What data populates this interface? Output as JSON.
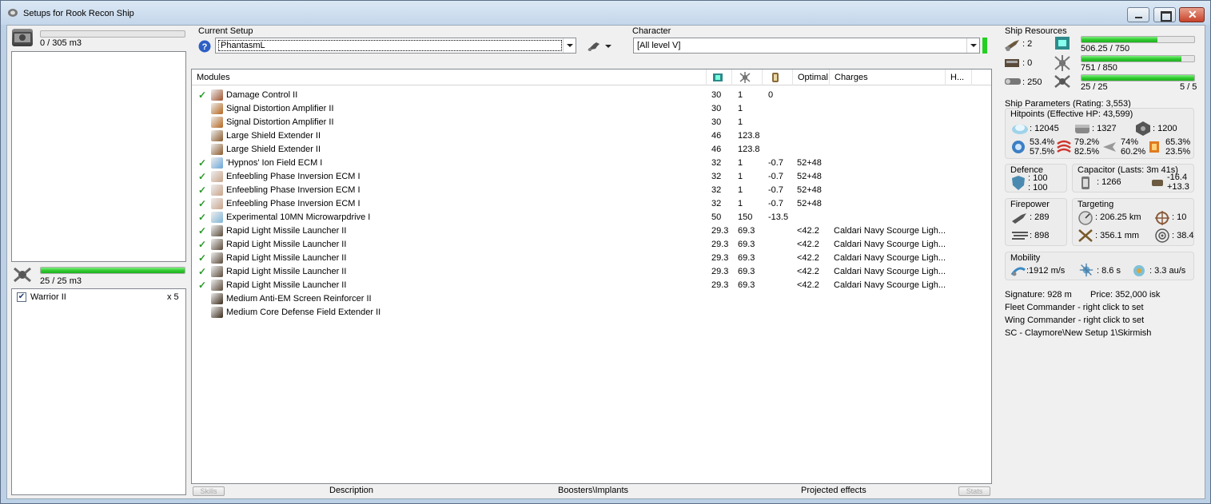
{
  "window": {
    "title": "Setups for Rook Recon Ship",
    "colors": {
      "frame": "#bcd0e6",
      "progress": "#2ec82e",
      "close": "#c7432b"
    }
  },
  "cargo": {
    "capacity_text": "0 / 305 m3",
    "fill": 0.0
  },
  "drones": {
    "capacity_text": "25 / 25 m3",
    "fill": 1.0,
    "items": [
      {
        "name": "Warrior II",
        "qty": "x 5",
        "checked": true
      }
    ]
  },
  "setup": {
    "label": "Current Setup",
    "value": "PhantasmL",
    "help_icon": "help-icon",
    "tools_icon": "wrench-icon"
  },
  "character": {
    "label": "Character",
    "value": "[All level V]"
  },
  "modules": {
    "headers": [
      "Modules",
      "",
      "",
      "",
      "Optimal",
      "Charges",
      "H..."
    ],
    "header_icons": [
      "cpu-icon",
      "powergrid-icon",
      "capacitor-icon"
    ],
    "rows": [
      {
        "active": true,
        "icon": "damage-control-icon",
        "color": "#a0522d",
        "name": "Damage Control II",
        "cpu": "30",
        "pg": "1",
        "cap": "0",
        "optimal": "",
        "charges": ""
      },
      {
        "active": false,
        "icon": "sig-amp-icon",
        "color": "#b5651d",
        "name": "Signal Distortion Amplifier II",
        "cpu": "30",
        "pg": "1",
        "cap": "",
        "optimal": "",
        "charges": ""
      },
      {
        "active": false,
        "icon": "sig-amp-icon",
        "color": "#b5651d",
        "name": "Signal Distortion Amplifier II",
        "cpu": "30",
        "pg": "1",
        "cap": "",
        "optimal": "",
        "charges": ""
      },
      {
        "active": false,
        "icon": "shield-extender-icon",
        "color": "#8b5a2b",
        "name": "Large Shield Extender II",
        "cpu": "46",
        "pg": "123.8",
        "cap": "",
        "optimal": "",
        "charges": ""
      },
      {
        "active": false,
        "icon": "shield-extender-icon",
        "color": "#8b5a2b",
        "name": "Large Shield Extender II",
        "cpu": "46",
        "pg": "123.8",
        "cap": "",
        "optimal": "",
        "charges": ""
      },
      {
        "active": true,
        "icon": "ecm-icon",
        "color": "#6aa6d8",
        "name": "'Hypnos' Ion Field ECM I",
        "cpu": "32",
        "pg": "1",
        "cap": "-0.7",
        "optimal": "52+48",
        "charges": ""
      },
      {
        "active": true,
        "icon": "ecm-icon",
        "color": "#c9a48a",
        "name": "Enfeebling Phase Inversion ECM I",
        "cpu": "32",
        "pg": "1",
        "cap": "-0.7",
        "optimal": "52+48",
        "charges": ""
      },
      {
        "active": true,
        "icon": "ecm-icon",
        "color": "#c9a48a",
        "name": "Enfeebling Phase Inversion ECM I",
        "cpu": "32",
        "pg": "1",
        "cap": "-0.7",
        "optimal": "52+48",
        "charges": ""
      },
      {
        "active": true,
        "icon": "ecm-icon",
        "color": "#c9a48a",
        "name": "Enfeebling Phase Inversion ECM I",
        "cpu": "32",
        "pg": "1",
        "cap": "-0.7",
        "optimal": "52+48",
        "charges": ""
      },
      {
        "active": true,
        "icon": "mwd-icon",
        "color": "#7fb5d6",
        "name": "Experimental 10MN Microwarpdrive I",
        "cpu": "50",
        "pg": "150",
        "cap": "-13.5",
        "optimal": "",
        "charges": ""
      },
      {
        "active": true,
        "icon": "missile-launcher-icon",
        "color": "#5a4a3a",
        "name": "Rapid Light Missile Launcher II",
        "cpu": "29.3",
        "pg": "69.3",
        "cap": "",
        "optimal": "<42.2",
        "charges": "Caldari Navy Scourge Ligh..."
      },
      {
        "active": true,
        "icon": "missile-launcher-icon",
        "color": "#5a4a3a",
        "name": "Rapid Light Missile Launcher II",
        "cpu": "29.3",
        "pg": "69.3",
        "cap": "",
        "optimal": "<42.2",
        "charges": "Caldari Navy Scourge Ligh..."
      },
      {
        "active": true,
        "icon": "missile-launcher-icon",
        "color": "#5a4a3a",
        "name": "Rapid Light Missile Launcher II",
        "cpu": "29.3",
        "pg": "69.3",
        "cap": "",
        "optimal": "<42.2",
        "charges": "Caldari Navy Scourge Ligh..."
      },
      {
        "active": true,
        "icon": "missile-launcher-icon",
        "color": "#5a4a3a",
        "name": "Rapid Light Missile Launcher II",
        "cpu": "29.3",
        "pg": "69.3",
        "cap": "",
        "optimal": "<42.2",
        "charges": "Caldari Navy Scourge Ligh..."
      },
      {
        "active": true,
        "icon": "missile-launcher-icon",
        "color": "#5a4a3a",
        "name": "Rapid Light Missile Launcher II",
        "cpu": "29.3",
        "pg": "69.3",
        "cap": "",
        "optimal": "<42.2",
        "charges": "Caldari Navy Scourge Ligh..."
      },
      {
        "active": false,
        "icon": "rig-icon",
        "color": "#3a2a1a",
        "name": "Medium Anti-EM Screen Reinforcer II",
        "cpu": "",
        "pg": "",
        "cap": "",
        "optimal": "",
        "charges": ""
      },
      {
        "active": false,
        "icon": "rig-icon",
        "color": "#3a2a1a",
        "name": "Medium Core Defense Field Extender II",
        "cpu": "",
        "pg": "",
        "cap": "",
        "optimal": "",
        "charges": ""
      }
    ]
  },
  "bottom_tabs": {
    "left_scroll": "Skills",
    "tabs": [
      "Description",
      "Boosters\\Implants",
      "Projected effects"
    ],
    "right_scroll": "Stats"
  },
  "resources": {
    "title": "Ship Resources",
    "turret_hardpoints": ": 2",
    "launcher_hardpoints": ": 0",
    "calibration": ": 250",
    "cpu_text": "506.25 / 750",
    "cpu_fill": 0.675,
    "pg_text": "751 / 850",
    "pg_fill": 0.884,
    "bandwidth_text": "25 / 25",
    "bandwidth_fill": 1.0,
    "drones_text": "5 / 5"
  },
  "parameters": {
    "title": "Ship Parameters (Rating: 3,553)",
    "hitpoints": {
      "title": "Hitpoints (Effective HP: 43,599)",
      "shield": ": 12045",
      "armor": ": 1327",
      "structure": ": 1200",
      "em": [
        "53.4%",
        "57.5%"
      ],
      "thermal": [
        "79.2%",
        "82.5%"
      ],
      "kinetic": [
        "74%",
        "60.2%"
      ],
      "explosive": [
        "65.3%",
        "23.5%"
      ]
    },
    "defence": {
      "title": "Defence",
      "a": ": 100",
      "b": ": 100"
    },
    "capacitor": {
      "title": "Capacitor (Lasts: 3m 41s)",
      "value": ": 1266",
      "a": "-16.4",
      "b": "+13.3"
    },
    "firepower": {
      "title": "Firepower",
      "dps": ": 289",
      "volley": ": 898"
    },
    "targeting": {
      "title": "Targeting",
      "range": ": 206.25 km",
      "targets": ": 10",
      "resolution": ": 356.1 mm",
      "sensor": ": 38.4"
    },
    "mobility": {
      "title": "Mobility",
      "speed": ":1912 m/s",
      "align": ": 8.6 s",
      "warp": ": 3.3 au/s"
    }
  },
  "summary": {
    "signature": "Signature: 928 m",
    "price": "Price: 352,000 isk",
    "fleet": "Fleet Commander - right click to set",
    "wing": "Wing Commander - right click to set",
    "path": "SC - Claymore\\New Setup 1\\Skirmish"
  }
}
